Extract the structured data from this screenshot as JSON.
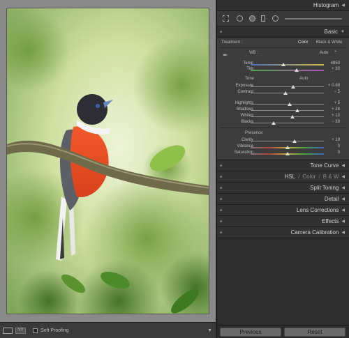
{
  "panels": {
    "histogram": "Histogram",
    "basic": "Basic",
    "tone_curve": "Tone Curve",
    "hsl": "HSL",
    "color": "Color",
    "bw": "B & W",
    "split_toning": "Split Toning",
    "detail": "Detail",
    "lens_corrections": "Lens Corrections",
    "effects": "Effects",
    "camera_calibration": "Camera Calibration",
    "slash": "/"
  },
  "basic": {
    "treatment_label": "Treatment :",
    "treatment_color": "Color",
    "treatment_bw": "Black & White",
    "wb_label": "WB :",
    "wb_value": "Auto",
    "tone_label": "Tone",
    "tone_auto": "Auto",
    "presence_label": "Presence",
    "sliders": {
      "temp": {
        "label": "Temp",
        "value": "4850",
        "level": 0.45
      },
      "tint": {
        "label": "Tint",
        "value": "+ 30",
        "level": 0.63
      },
      "exposure": {
        "label": "Exposure",
        "value": "+ 0.88",
        "level": 0.58
      },
      "contrast": {
        "label": "Contrast",
        "value": "− 5",
        "level": 0.48
      },
      "highlights": {
        "label": "Highlights",
        "value": "+ 5",
        "level": 0.53
      },
      "shadows": {
        "label": "Shadows",
        "value": "+ 28",
        "level": 0.64
      },
      "whites": {
        "label": "Whites",
        "value": "+ 13",
        "level": 0.57
      },
      "blacks": {
        "label": "Blacks",
        "value": "− 39",
        "level": 0.31
      },
      "clarity": {
        "label": "Clarity",
        "value": "+ 19",
        "level": 0.6
      },
      "vibrance": {
        "label": "Vibrance",
        "value": "0",
        "level": 0.5
      },
      "saturation": {
        "label": "Saturation",
        "value": "0",
        "level": 0.5
      }
    }
  },
  "toolbar": {
    "soft_proofing": "Soft Proofing",
    "view_mode": "YY"
  },
  "buttons": {
    "previous": "Previous",
    "reset": "Reset"
  }
}
